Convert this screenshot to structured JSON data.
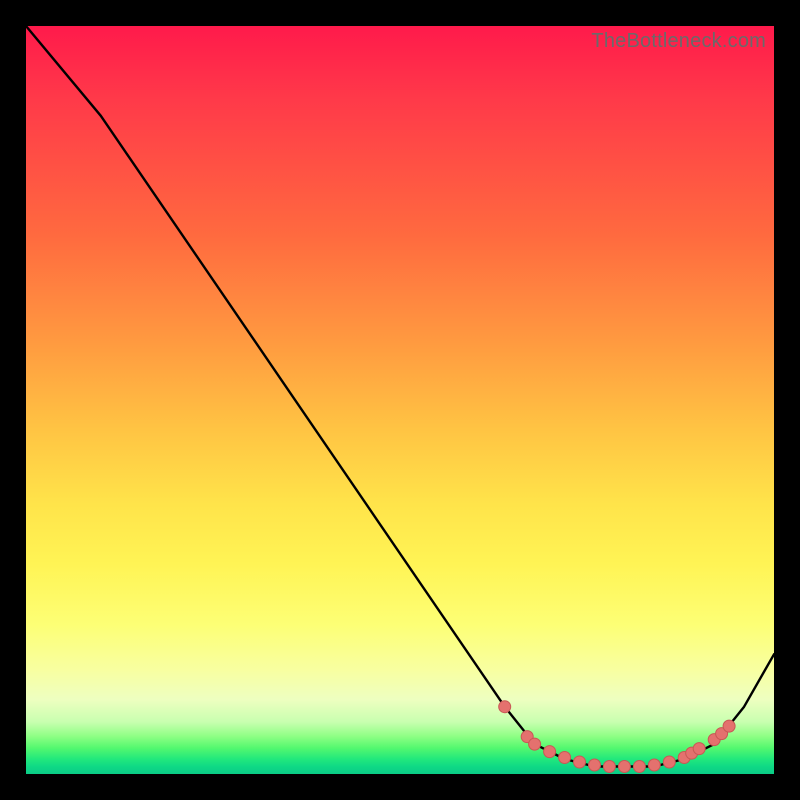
{
  "watermark": "TheBottleneck.com",
  "colors": {
    "curve": "#000000",
    "marker_fill": "#e4716e",
    "marker_stroke": "#c85855"
  },
  "chart_data": {
    "type": "line",
    "title": "",
    "xlabel": "",
    "ylabel": "",
    "xlim": [
      0,
      100
    ],
    "ylim": [
      0,
      100
    ],
    "series": [
      {
        "name": "curve",
        "x": [
          0,
          10,
          64,
          68,
          72,
          76,
          80,
          84,
          88,
          92,
          96,
          100
        ],
        "y": [
          100,
          88,
          9,
          4,
          2,
          1,
          1,
          1,
          2,
          4,
          9,
          16
        ]
      }
    ],
    "markers": {
      "name": "highlight-points",
      "x": [
        64,
        67,
        68,
        70,
        72,
        74,
        76,
        78,
        80,
        82,
        84,
        86,
        88,
        89,
        90,
        92,
        93,
        94
      ],
      "y": [
        9,
        5,
        4,
        3,
        2.2,
        1.6,
        1.2,
        1.0,
        1.0,
        1.0,
        1.2,
        1.6,
        2.2,
        2.8,
        3.4,
        4.6,
        5.4,
        6.4
      ]
    }
  }
}
